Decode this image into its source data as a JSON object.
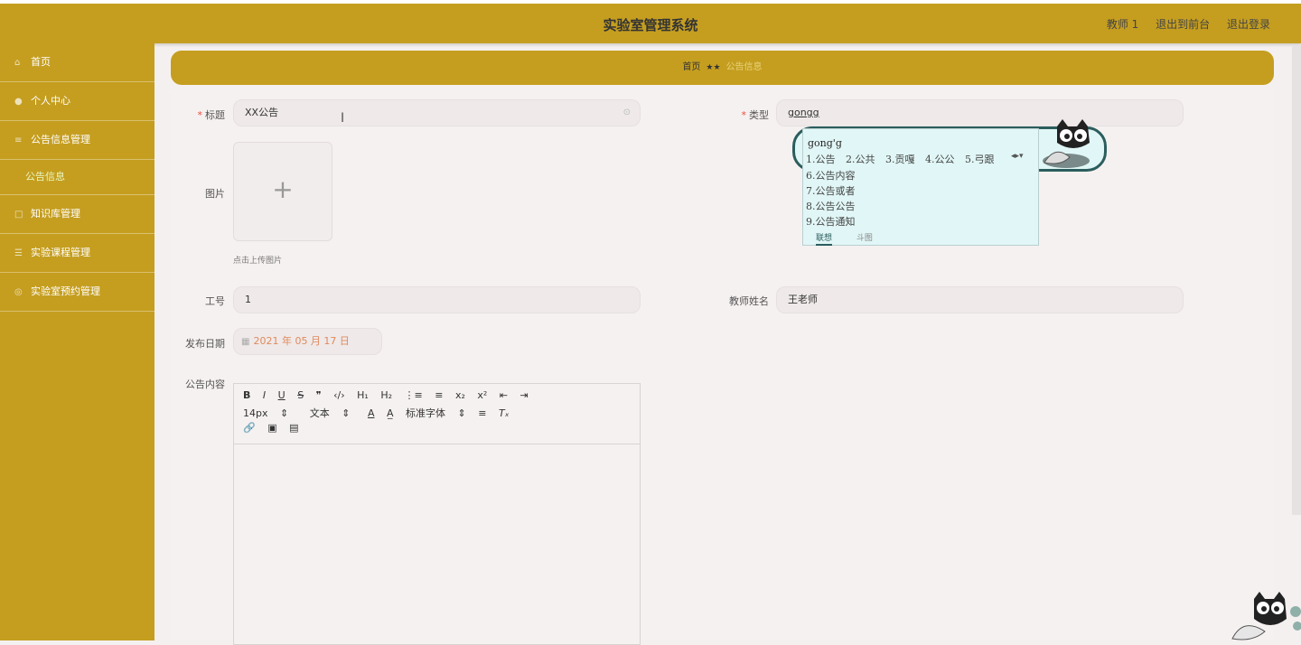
{
  "header": {
    "title": "实验室管理系统",
    "user": "教师 1",
    "links": [
      "退出到前台",
      "退出登录"
    ]
  },
  "sidebar": {
    "items": [
      {
        "icon": "home-icon",
        "label": "首页"
      },
      {
        "icon": "user-icon",
        "label": "个人中心"
      },
      {
        "icon": "list-icon",
        "label": "公告信息管理"
      },
      {
        "icon": "",
        "label": "公告信息",
        "sub": true
      },
      {
        "icon": "book-icon",
        "label": "知识库管理"
      },
      {
        "icon": "course-icon",
        "label": "实验课程管理"
      },
      {
        "icon": "calendar-icon",
        "label": "实验室预约管理"
      }
    ]
  },
  "breadcrumb": {
    "home": "首页",
    "sep": "★★",
    "current": "公告信息"
  },
  "form": {
    "title_label": "标题",
    "title_value": "XX公告",
    "type_label": "类型",
    "type_value": "gongg",
    "image_label": "图片",
    "upload_tip": "点击上传图片",
    "upload_plus": "+",
    "staff_no_label": "工号",
    "staff_no_value": "1",
    "teacher_label": "教师姓名",
    "teacher_value": "王老师",
    "date_label": "发布日期",
    "date_value": "2021 年 05 月 17 日",
    "content_label": "公告内容"
  },
  "editor": {
    "row1": [
      "B",
      "I",
      "U",
      "S",
      "❞",
      "‹/›",
      "H₁",
      "H₂",
      "⋮≡",
      "≡",
      "x₂",
      "x²",
      "⇤",
      "⇥"
    ],
    "row2": [
      "14px",
      "⇕",
      "文本",
      "⇕",
      "A",
      "A̲",
      "标准字体",
      "⇕",
      "≡",
      "Tₓ"
    ],
    "row3": [
      "🔗",
      "▣",
      "▤"
    ]
  },
  "ime": {
    "pinyin": "gong'g",
    "candidates": [
      "1.公告",
      "2.公共",
      "3.贡嘎",
      "4.公公",
      "5.弓跟"
    ],
    "more": [
      "6.公告内容",
      "7.公告或者",
      "8.公告公告",
      "9.公告通知"
    ],
    "tabs": [
      "联想",
      "斗图"
    ]
  }
}
